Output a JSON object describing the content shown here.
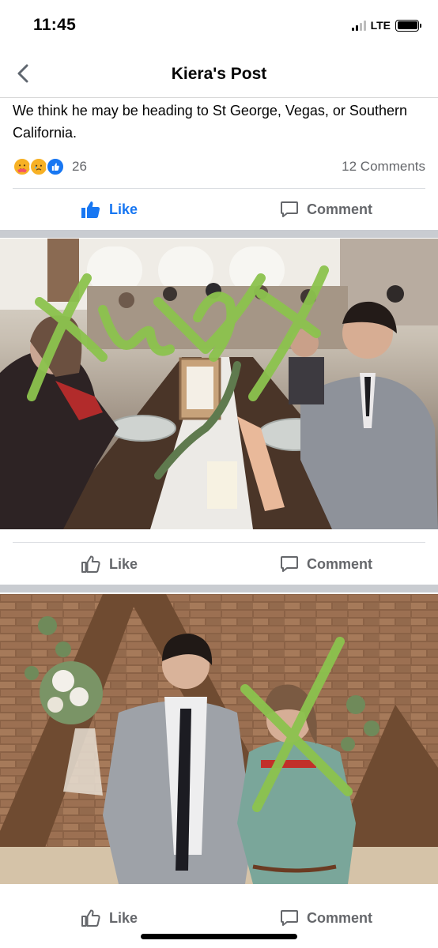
{
  "status_bar": {
    "time": "11:45",
    "network": "LTE"
  },
  "header": {
    "title": "Kiera's Post"
  },
  "post": {
    "text": "We think he may be heading to St George, Vegas, or Southern California.",
    "reaction_count": "26",
    "comment_count": "12 Comments",
    "reactions": [
      "care-emoji-icon",
      "sad-emoji-icon",
      "like-reaction-icon"
    ]
  },
  "actions": {
    "like_label": "Like",
    "comment_label": "Comment"
  },
  "colors": {
    "brand_blue": "#1877f2",
    "secondary_text": "#65676b",
    "separator": "#c9ccd1",
    "redaction_green": "#8cc34e"
  },
  "photos": [
    {
      "description_icon": "wedding-table-photo"
    },
    {
      "description_icon": "couple-portrait-photo"
    }
  ]
}
